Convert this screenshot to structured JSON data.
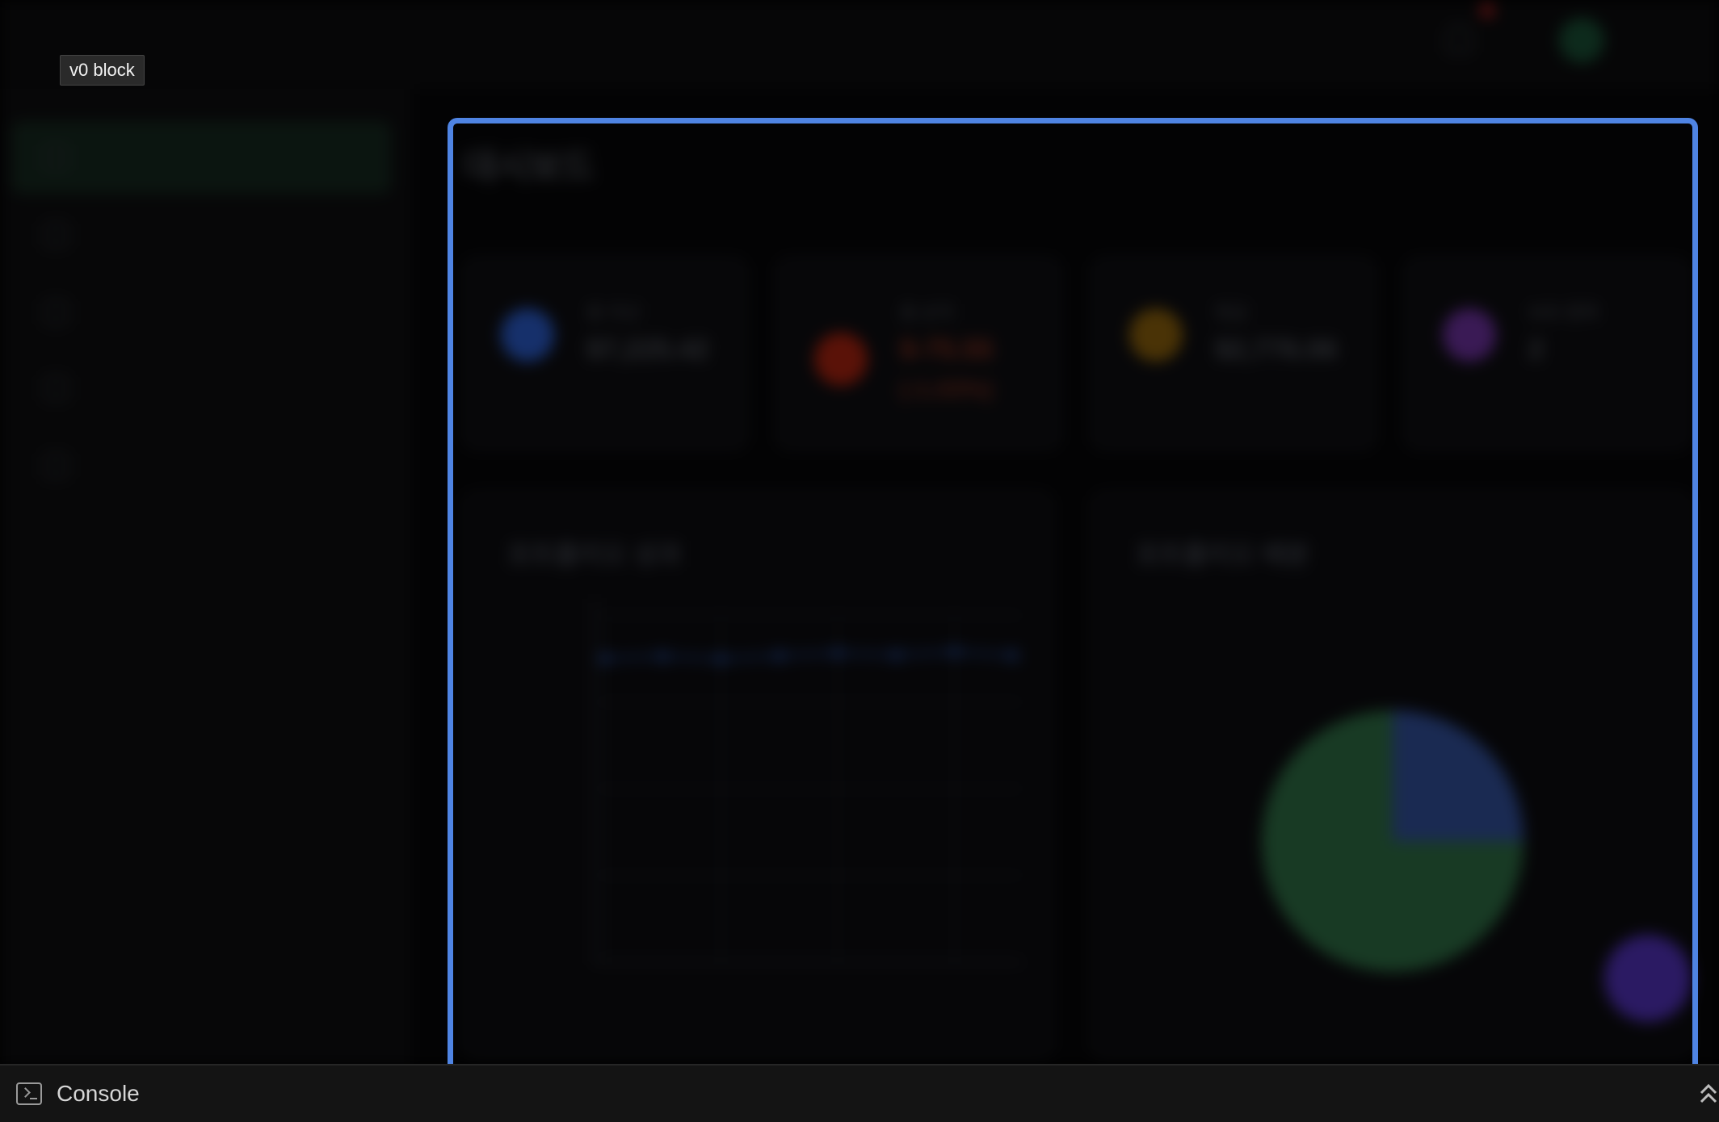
{
  "preview": {
    "brand": "",
    "user": {
      "name": ""
    },
    "sidebar": {
      "items": [
        {
          "label": "",
          "active": true
        },
        {
          "label": "",
          "active": false
        },
        {
          "label": "",
          "active": false
        },
        {
          "label": "",
          "active": false
        },
        {
          "label": "",
          "active": false
        }
      ]
    },
    "dashboard": {
      "title": "대시보드",
      "subtitle": "",
      "stats": [
        {
          "label": "총 자산",
          "value": "$7,225.42",
          "change": "",
          "icon_color": "#16306b"
        },
        {
          "label": "총 손익",
          "value": "$-75.55",
          "change": "(-1.03%)",
          "icon_color": "#5a1208",
          "value_color": "#4a1a10"
        },
        {
          "label": "현금",
          "value": "$2,776.06",
          "change": "",
          "icon_color": "#4a3306"
        },
        {
          "label": "보유 종목",
          "value": "2",
          "change": "",
          "icon_color": "#3a1a55"
        }
      ],
      "performance_panel": {
        "title": "포트폴리오 성과"
      },
      "allocation_panel": {
        "title": "포트폴리오 배분"
      }
    }
  },
  "chart_data": [
    {
      "type": "line",
      "title": "포트폴리오 성과",
      "x": [
        "",
        "",
        "",
        "",
        "",
        "",
        "",
        ""
      ],
      "series": [
        {
          "values": [
            7000,
            7050,
            6990,
            7060,
            7120,
            7080,
            7150,
            7070
          ]
        }
      ],
      "ylim": [
        0,
        8000
      ],
      "grid": true,
      "color": "#12244a"
    },
    {
      "type": "pie",
      "title": "포트폴리오 배분",
      "slices": [
        {
          "label": "",
          "value": 75,
          "color": "#183a24"
        },
        {
          "label": "",
          "value": 25,
          "color": "#1a2a52"
        }
      ]
    }
  ],
  "overlay": {
    "badge": "v0 block",
    "console_label": "Console",
    "selection_color": "#4f84e3"
  }
}
